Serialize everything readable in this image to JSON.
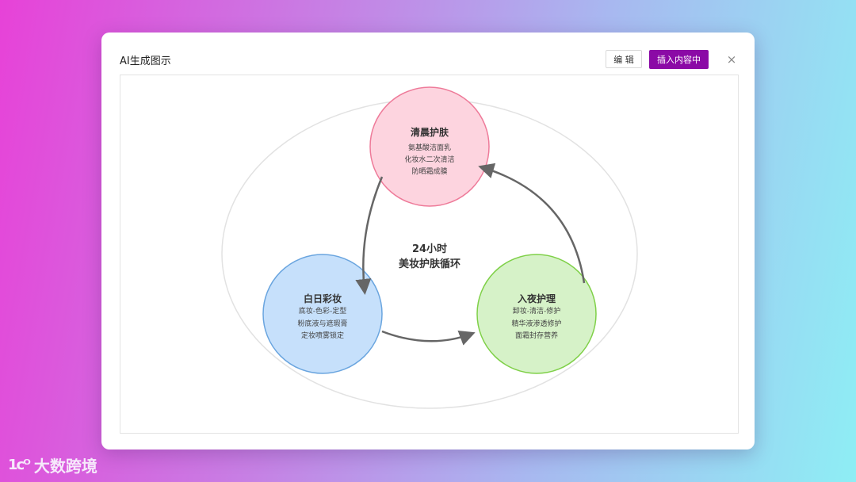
{
  "modal": {
    "title": "AI生成图示",
    "edit_label": "编 辑",
    "insert_label": "插入内容中",
    "close_label": "×"
  },
  "diagram": {
    "center_lines": [
      "24小时",
      "美妆护肤循环"
    ],
    "nodes": [
      {
        "id": "morning",
        "title": "清晨护肤",
        "lines": [
          "氨基酸洁面乳",
          "化妆水二次清洁",
          "防晒霜成膜"
        ],
        "fill": "#fdd4df",
        "stroke": "#ee7a99"
      },
      {
        "id": "daytime",
        "title": "白日彩妆",
        "lines": [
          "底妆-色彩-定型",
          "粉底液与遮瑕膏",
          "定妆喷雾锁定"
        ],
        "fill": "#c6e0fb",
        "stroke": "#6aa5df"
      },
      {
        "id": "night",
        "title": "入夜护理",
        "lines": [
          "卸妆-清洁-修护",
          "精华液渗透修护",
          "面霜封存营养"
        ],
        "fill": "#d6f2c8",
        "stroke": "#7fd048"
      }
    ],
    "colors": {
      "arrow": "#666666",
      "outer_ellipse": "#e2e2e2"
    }
  },
  "watermark": {
    "mark": "1ᴄᴼ",
    "text": "大数跨境"
  }
}
